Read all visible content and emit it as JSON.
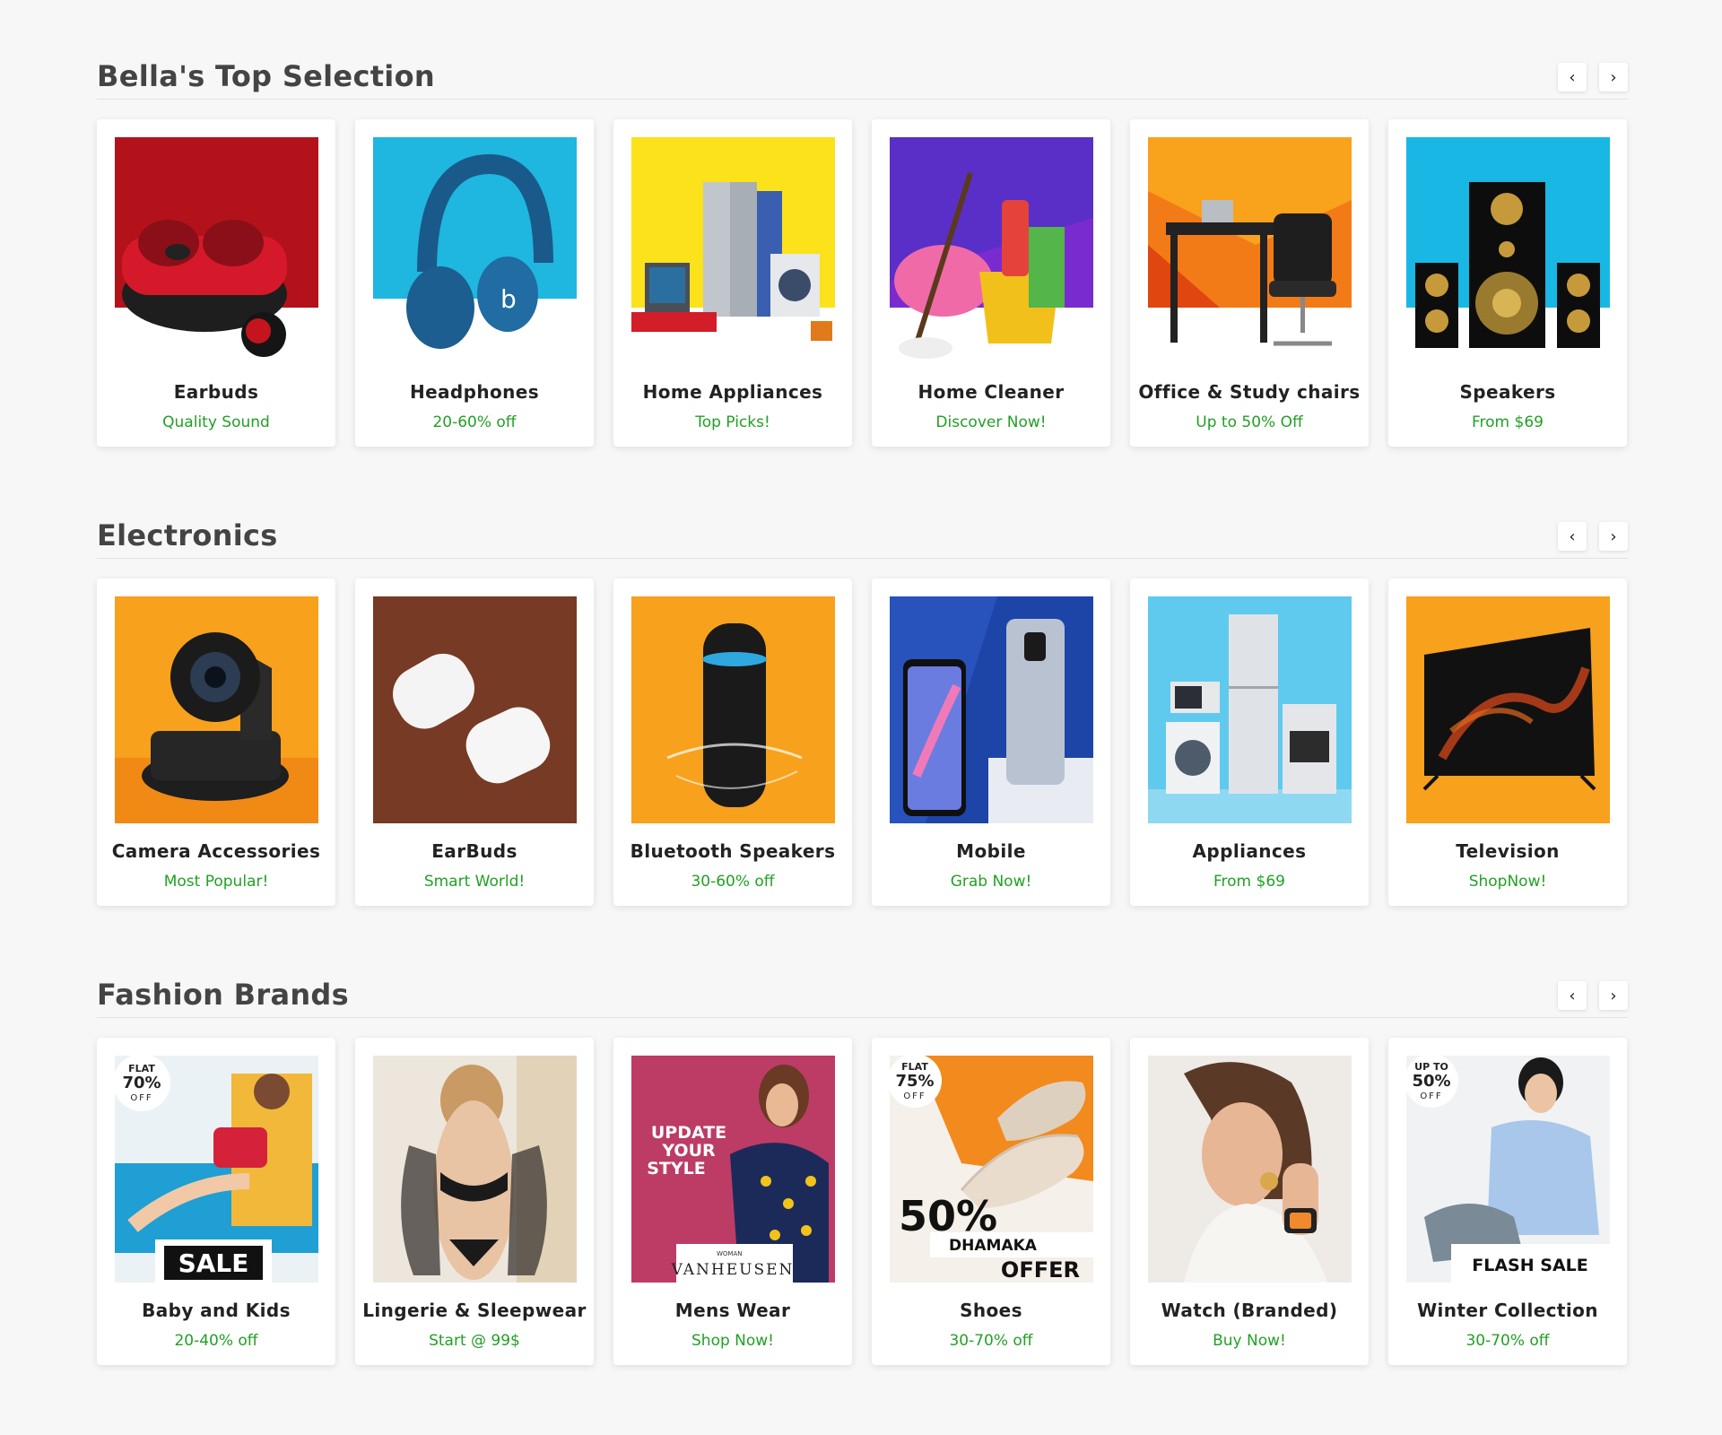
{
  "sections": [
    {
      "title": "Bella's Top Selection",
      "prev_icon": "chevron-left-icon",
      "next_icon": "chevron-right-icon",
      "items": [
        {
          "name": "Earbuds",
          "offer": "Quality Sound",
          "image": "earbuds-image"
        },
        {
          "name": "Headphones",
          "offer": "20-60% off",
          "image": "headphones-image"
        },
        {
          "name": "Home Appliances",
          "offer": "Top Picks!",
          "image": "home-appliances-image"
        },
        {
          "name": "Home Cleaner",
          "offer": "Discover Now!",
          "image": "home-cleaner-image"
        },
        {
          "name": "Office & Study chairs",
          "offer": "Up to 50% Off",
          "image": "office-chair-image"
        },
        {
          "name": "Speakers",
          "offer": "From $69",
          "image": "speakers-image"
        }
      ]
    },
    {
      "title": "Electronics",
      "prev_icon": "chevron-left-icon",
      "next_icon": "chevron-right-icon",
      "items": [
        {
          "name": "Camera Accessories",
          "offer": "Most Popular!",
          "image": "camera-image"
        },
        {
          "name": "EarBuds",
          "offer": "Smart World!",
          "image": "earbuds-cases-image"
        },
        {
          "name": "Bluetooth Speakers",
          "offer": "30-60% off",
          "image": "bluetooth-speaker-image"
        },
        {
          "name": "Mobile",
          "offer": "Grab Now!",
          "image": "mobile-image"
        },
        {
          "name": "Appliances",
          "offer": "From $69",
          "image": "appliances-image"
        },
        {
          "name": "Television",
          "offer": "ShopNow!",
          "image": "television-image"
        }
      ]
    },
    {
      "title": "Fashion Brands",
      "prev_icon": "chevron-left-icon",
      "next_icon": "chevron-right-icon",
      "items": [
        {
          "name": "Baby and Kids",
          "offer": "20-40% off",
          "image": "baby-kids-image",
          "badge": [
            "FLAT",
            "70%",
            "OFF"
          ],
          "banner": "SALE"
        },
        {
          "name": "Lingerie & Sleepwear",
          "offer": "Start @ 99$",
          "image": "lingerie-image"
        },
        {
          "name": "Mens Wear",
          "offer": "Shop Now!",
          "image": "mens-wear-image",
          "overlay": [
            "UPDATE",
            "YOUR",
            "STYLE"
          ],
          "brand_small": "WOMAN",
          "brand": "VANHEUSEN"
        },
        {
          "name": "Shoes",
          "offer": "30-70% off",
          "image": "shoes-image",
          "badge": [
            "FLAT",
            "75%",
            "OFF"
          ],
          "promo": [
            "50%",
            "DHAMAKA",
            "OFFER"
          ]
        },
        {
          "name": "Watch (Branded)",
          "offer": "Buy Now!",
          "image": "watch-image"
        },
        {
          "name": "Winter Collection",
          "offer": "30-70% off",
          "image": "winter-collection-image",
          "badge": [
            "UP TO",
            "50%",
            "OFF"
          ],
          "banner": "FLASH SALE"
        }
      ]
    }
  ],
  "colors": {
    "offer_text": "#22a025",
    "title_text": "#444444",
    "page_bg": "#f7f7f7"
  }
}
